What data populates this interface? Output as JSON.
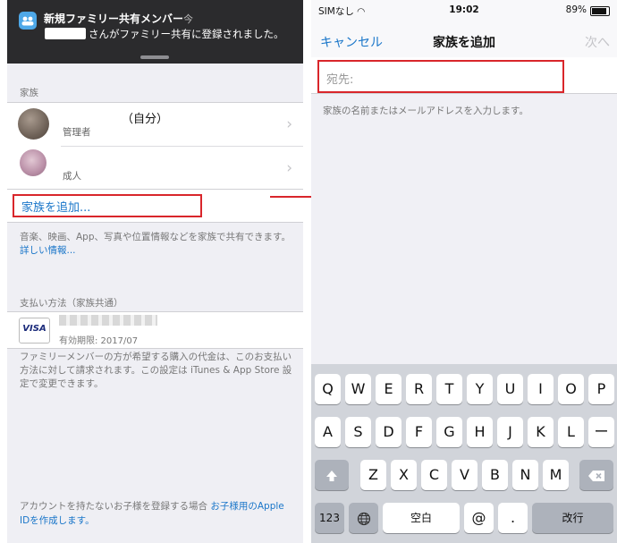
{
  "left": {
    "notification": {
      "title": "新規ファミリー共有メンバー",
      "time": "今",
      "body": "さんがファミリー共有に登録されました。"
    },
    "family_header": "家族",
    "members": [
      {
        "name": "（自分）",
        "role": "管理者"
      },
      {
        "name": "",
        "role": "成人"
      }
    ],
    "add_family": "家族を追加...",
    "share_note": "音楽、映画、App、写真や位置情報などを家族で共有できます。",
    "share_link": "詳しい情報...",
    "payment_header": "支払い方法（家族共通）",
    "payment": {
      "card_brand": "VISA",
      "expiry": "有効期限: 2017/07"
    },
    "payment_note": "ファミリーメンバーの方が希望する購入の代金は、このお支払い方法に対して請求されます。この設定は iTunes & App Store 設定で変更できます。",
    "kids_note": "アカウントを持たないお子様を登録する場合 ",
    "kids_link": "お子様用のApple IDを作成します。"
  },
  "right": {
    "status": {
      "carrier": "SIMなし",
      "time": "19:02",
      "battery": "89%"
    },
    "nav": {
      "cancel": "キャンセル",
      "title": "家族を追加",
      "next": "次へ"
    },
    "to_label": "宛先:",
    "hint": "家族の名前またはメールアドレスを入力します。",
    "keyboard": {
      "row1": [
        "Q",
        "W",
        "E",
        "R",
        "T",
        "Y",
        "U",
        "I",
        "O",
        "P"
      ],
      "row2": [
        "A",
        "S",
        "D",
        "F",
        "G",
        "H",
        "J",
        "K",
        "L",
        "ー"
      ],
      "row3": [
        "Z",
        "X",
        "C",
        "V",
        "B",
        "N",
        "M"
      ],
      "num": "123",
      "space": "空白",
      "at": "@",
      "dot": ".",
      "return": "改行"
    }
  },
  "colors": {
    "accent": "#1a76c9",
    "highlight": "#d9262b"
  },
  "icons": [
    "family-sharing-icon",
    "chevron-right-icon",
    "visa-card-icon",
    "wifi-icon",
    "battery-icon",
    "shift-icon",
    "delete-icon",
    "globe-icon",
    "arrow-icon"
  ]
}
